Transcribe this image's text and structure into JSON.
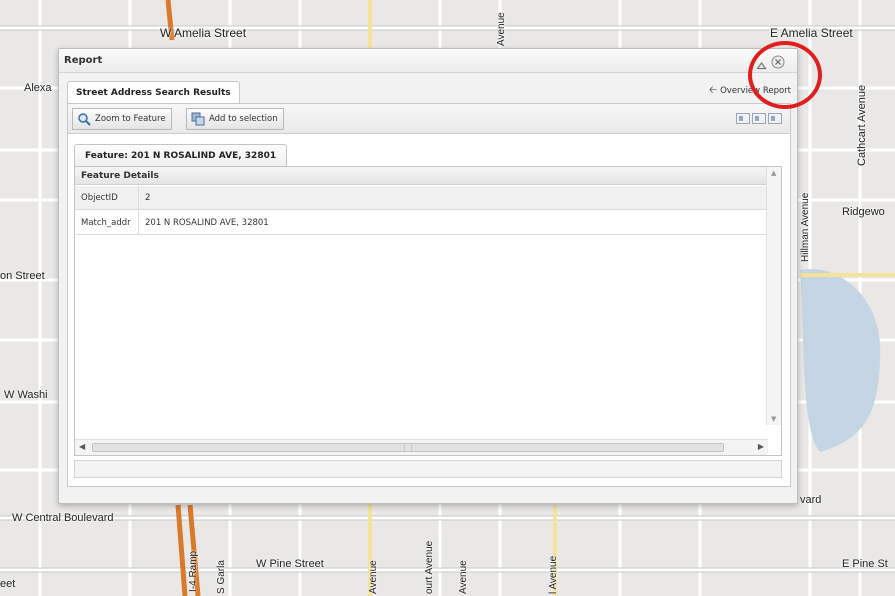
{
  "map": {
    "labels": {
      "w_amelia": "W Amelia Street",
      "e_amelia": "E Amelia Street",
      "alexa": "Alexa",
      "avenue_top": "Avenue",
      "cathcart": "Cathcart Avenue",
      "ridgewood": "Ridgewo",
      "hillman": "Hillman Avenue",
      "on_street": "on Street",
      "w_washi": "W Washi",
      "vard": "vard",
      "w_central": "W Central Boulevard",
      "w_pine": "W Pine Street",
      "e_pine": "E Pine St",
      "eet": "eet",
      "i4_ramp": "I-4 Ramp",
      "s_garl": "S Garla",
      "avenue_b1": "Avenue",
      "court_avenue": "ourt Avenue",
      "avenue_b2": "Avenue",
      "avenue_b3": "l Avenue"
    }
  },
  "window": {
    "title": "Report",
    "outer_tab": "Street Address Search Results",
    "overview_link": "Overview Report",
    "toolbar": {
      "zoom_label": "Zoom to Feature",
      "add_label": "Add to selection"
    },
    "feature_tab": "Feature: 201 N ROSALIND AVE, 32801",
    "details_header": "Feature Details",
    "rows": [
      {
        "key": "ObjectID",
        "value": "2"
      },
      {
        "key": "Match_addr",
        "value": "201 N ROSALIND AVE, 32801"
      }
    ]
  },
  "colors": {
    "highlight": "#e21d1d",
    "highway": "#d97a2b"
  },
  "icons": [
    "collapse-icon",
    "close-icon",
    "zoom-icon",
    "add-selection-icon",
    "arrow-left-icon",
    "layout-icon"
  ]
}
